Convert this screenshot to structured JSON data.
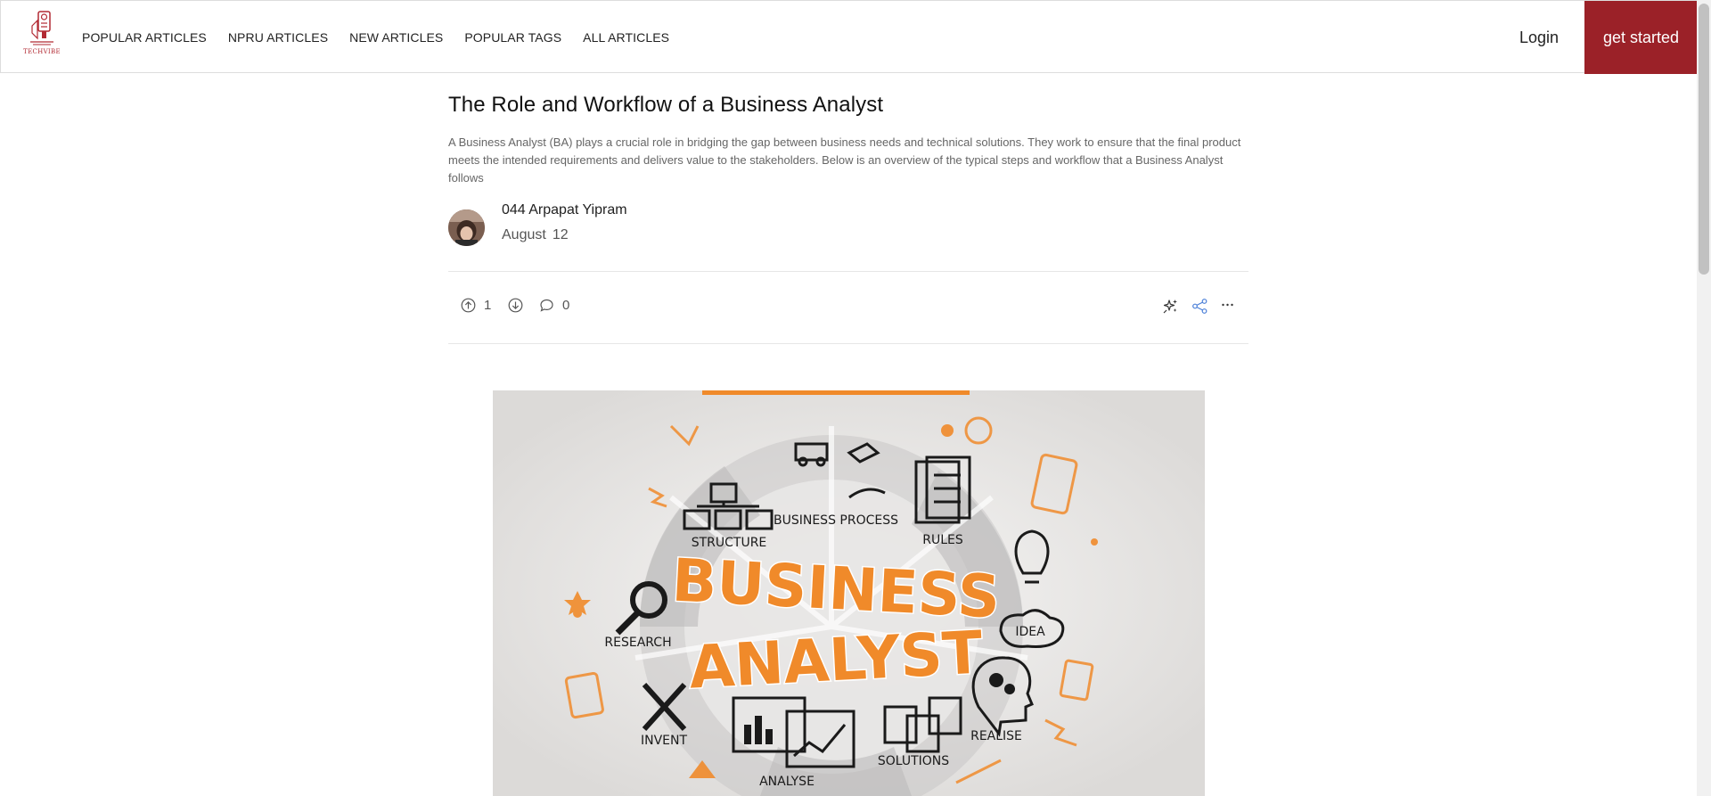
{
  "header": {
    "logo_text": "TECHVIBE",
    "nav": [
      "POPULAR ARTICLES",
      "NPRU ARTICLES",
      "NEW ARTICLES",
      "POPULAR TAGS",
      "ALL ARTICLES"
    ],
    "login_label": "Login",
    "get_started_label": "get started",
    "accent_color": "#9b2128"
  },
  "article": {
    "title": "The Role and Workflow of a Business Analyst",
    "summary": "A Business Analyst (BA) plays a crucial role in bridging the gap between business needs and technical solutions. They work to ensure that the final product meets the intended requirements and delivers value to the stakeholders. Below is an overview of the typical steps and workflow that a Business Analyst follows",
    "author": "044 Arpapat Yipram",
    "date_month": "August",
    "date_day": "12",
    "upvotes": "1",
    "comments": "0",
    "action_icons": [
      "upvote-icon",
      "downvote-icon",
      "comment-icon",
      "sparkle-icon",
      "share-icon",
      "more-icon"
    ]
  },
  "hero_image": {
    "heading": "BUSINESS ANALYST",
    "labels": [
      "STRUCTURE",
      "BUSINESS PROCESS",
      "RULES",
      "IDEA",
      "RESEARCH",
      "INVENT",
      "ANALYSE",
      "SOLUTIONS",
      "REALISE"
    ],
    "accent_color": "#f08a2a"
  }
}
